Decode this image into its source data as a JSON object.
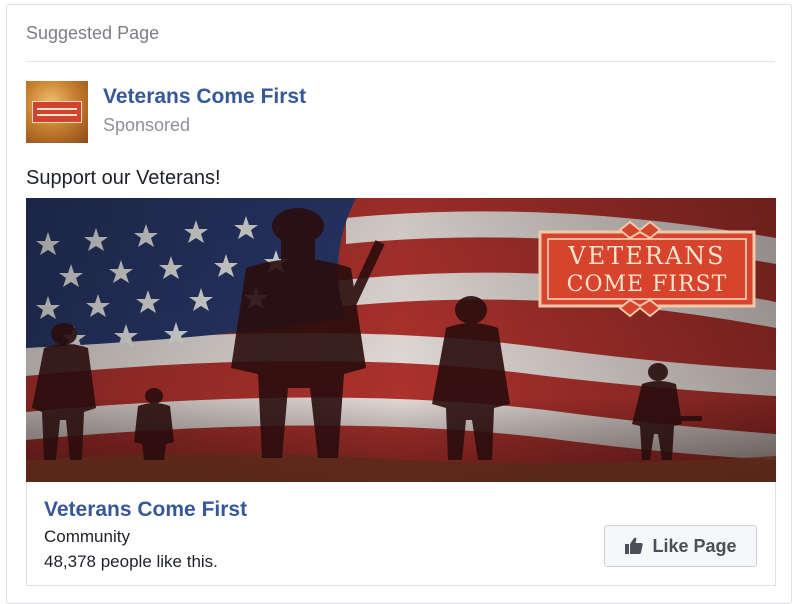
{
  "card": {
    "header_label": "Suggested Page"
  },
  "page": {
    "name": "Veterans Come First",
    "sponsored_label": "Sponsored",
    "thumbnail_icon": "veterans-come-first-logo"
  },
  "post": {
    "text": "Support our Veterans!"
  },
  "hero": {
    "badge_line1": "VETERANS",
    "badge_line2": "COME FIRST",
    "colors": {
      "flag_red": "#b5342f",
      "flag_white": "#efe6e2",
      "flag_blue": "#2b3a6e",
      "silhouette": "#2a0d0d",
      "badge_fill": "#d8432e",
      "badge_text": "#f8e4cc"
    }
  },
  "link_preview": {
    "title": "Veterans Come First",
    "category": "Community",
    "likes_text": "48,378 people like this.",
    "like_button_label": "Like Page",
    "like_icon": "thumbs-up-icon"
  },
  "colors": {
    "link_blue": "#365899",
    "muted_gray": "#8d9096",
    "body_text": "#1d2129"
  }
}
